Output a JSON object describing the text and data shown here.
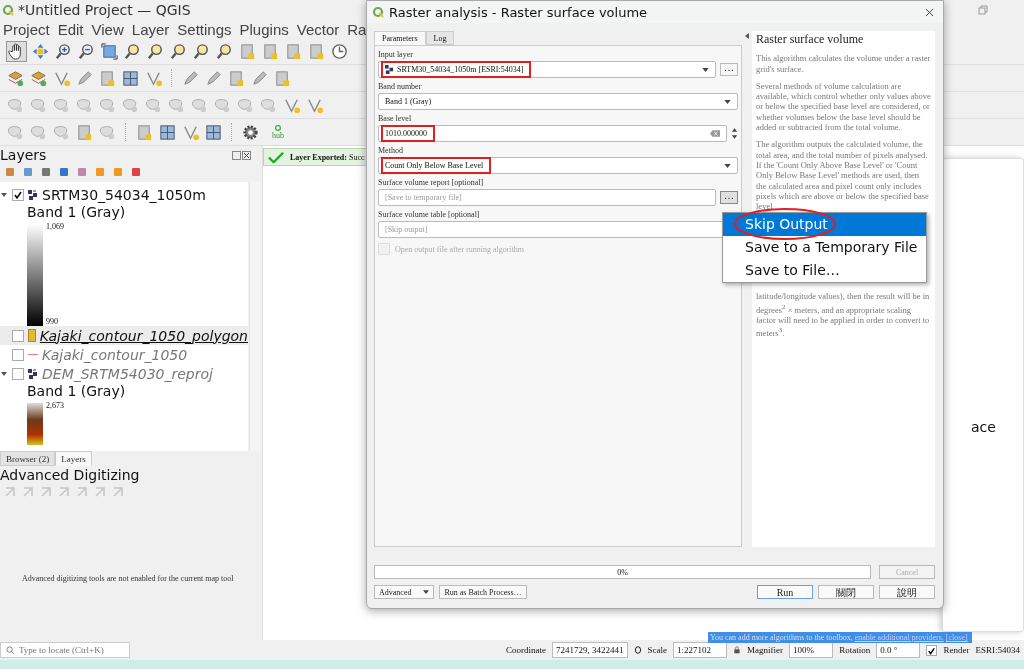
{
  "window": {
    "title": "*Untitled Project — QGIS"
  },
  "menu": [
    "Project",
    "Edit",
    "View",
    "Layer",
    "Settings",
    "Plugins",
    "Vector",
    "Ra"
  ],
  "toolbar": {
    "hub_label": "hub"
  },
  "layers_panel": {
    "title": "Layers",
    "layers": [
      {
        "name": "SRTM30_54034_1050m",
        "kind": "raster",
        "checked": true,
        "selected": false,
        "expanded": true,
        "children": [
          {
            "label": "Band 1 (Gray)",
            "kind": "gray",
            "max": "1,069",
            "min": "990"
          }
        ]
      },
      {
        "name": "Kajaki_contour_1050_polygon",
        "kind": "polygon",
        "checked": false,
        "selected": true,
        "color": "#e8b830"
      },
      {
        "name": "Kajaki_contour_1050",
        "kind": "line",
        "checked": false,
        "selected": false,
        "color": "#f08080"
      },
      {
        "name": "DEM_SRTM54030_reproj",
        "kind": "raster",
        "checked": false,
        "selected": false,
        "expanded": true,
        "children": [
          {
            "label": "Band 1 (Gray)",
            "kind": "terrain",
            "max": "2,673"
          }
        ]
      }
    ]
  },
  "panel_tabs": [
    {
      "label": "Browser (2)",
      "selected": false
    },
    {
      "label": "Layers",
      "selected": true
    }
  ],
  "digitizing_panel": {
    "title": "Advanced Digitizing",
    "message": "Advanced digitizing tools are not enabled for the current map tool"
  },
  "locator": {
    "placeholder": "Type to locate (Ctrl+K)"
  },
  "message_bar": {
    "text": "**Layer Exported:** Succ"
  },
  "background_panel": {
    "text": "ace"
  },
  "dialog": {
    "title": "Raster analysis - Raster surface volume",
    "tabs": [
      {
        "label": "Parameters",
        "selected": true
      },
      {
        "label": "Log",
        "selected": false
      }
    ],
    "parameters": [
      {
        "kind": "layer",
        "label": "Input layer",
        "value": "SRTM30_54034_1050m [ESRI:54034]",
        "highlighted": true,
        "button": "…"
      },
      {
        "kind": "combo",
        "label": "Band number",
        "value": "Band 1 (Gray)",
        "highlighted": false
      },
      {
        "kind": "number",
        "label": "Base level",
        "value": "1010.000000",
        "highlighted": true
      },
      {
        "kind": "combo",
        "label": "Method",
        "value": "Count Only Below Base Level",
        "highlighted": true
      },
      {
        "kind": "output",
        "label": "Surface volume report [optional]",
        "placeholder": "[Save to temporary file]",
        "button": "…",
        "open": true
      },
      {
        "kind": "output",
        "label": "Surface volume table [optional]",
        "placeholder": "[Skip output]"
      },
      {
        "kind": "checkbox",
        "label": "Open output file after running algorithm",
        "checked": false,
        "disabled": true
      }
    ],
    "help": {
      "title": "Raster surface volume",
      "paragraphs": [
        "This algorithm calculates the volume under a raster grid's surface.",
        "Several methods of volume calculation are available, which control whether only values above or below the specified base level are considered, or whether volumes below the base level should be added or subtracted from the total volume.",
        "The algorithm outputs the calculated volume, the total area, and the total number of pixels analysed. If the 'Count Only Above Base Level' or 'Count Only Below Base Level' methods are used, then the calculated area and pixel count only includes pixels which are above or below the specified base level"
      ],
      "tail": "latitude/longitude values), then the result will be in degrees$^{2}$ × meters, and an appropriate scaling factor will need to be applied in order to convert to meters$^{3}$."
    },
    "progress": {
      "label": "0%",
      "level": 0
    },
    "cancel": {
      "label": "Cancel",
      "disabled": true
    },
    "left_buttons": [
      "Advanced",
      "Run as Batch Process…"
    ],
    "right_buttons": [
      "Run",
      "關閉",
      "說明"
    ]
  },
  "output_menu": [
    {
      "label": "Skip Output",
      "selected": true,
      "circled": true
    },
    {
      "label": "Save to a Temporary File",
      "selected": false,
      "circled": false
    },
    {
      "label": "Save to File…",
      "selected": false,
      "circled": false
    }
  ],
  "status_bar": {
    "coordinate_label": "Coordinate",
    "coordinate": "7241729, 3422441",
    "scale_label": "Scale",
    "scale": "1:227102",
    "magnifier_label": "Magnifier",
    "magnifier": "100%",
    "rotation_label": "Rotation",
    "rotation": "0.0 °",
    "render_label": "Render",
    "render": true,
    "crs": "ESRI:54034"
  },
  "notification": {
    "text": "You can add more algorithms to the toolbox, ",
    "link": "enable additional providers.",
    "close": "[close]"
  }
}
